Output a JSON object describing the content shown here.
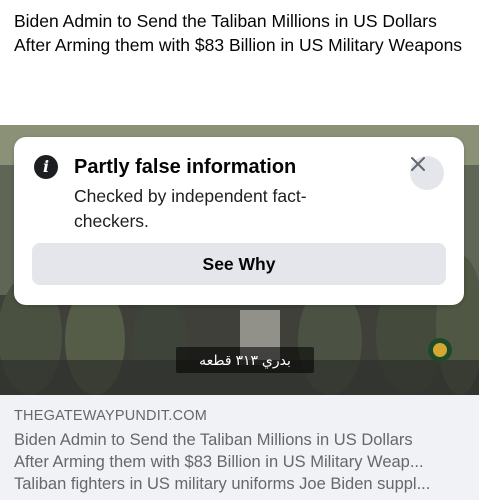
{
  "post": {
    "text": "Biden Admin to Send the Taliban Millions in US Dollars After Arming them with $83 Billion in US Military Weapons"
  },
  "media": {
    "caption": "بدري ٣١٣ قطعه"
  },
  "warning": {
    "icon": "info-icon",
    "title": "Partly false information",
    "subtitle": "Checked by independent fact-checkers.",
    "close_icon": "close-icon",
    "button_label": "See Why"
  },
  "link_preview": {
    "domain": "THEGATEWAYPUNDIT.COM",
    "title_line1": "Biden Admin to Send the Taliban Millions in US Dollars",
    "title_line2": "After Arming them with $83 Billion in US Military Weap...",
    "description": "Taliban fighters in US military uniforms Joe Biden suppl..."
  }
}
